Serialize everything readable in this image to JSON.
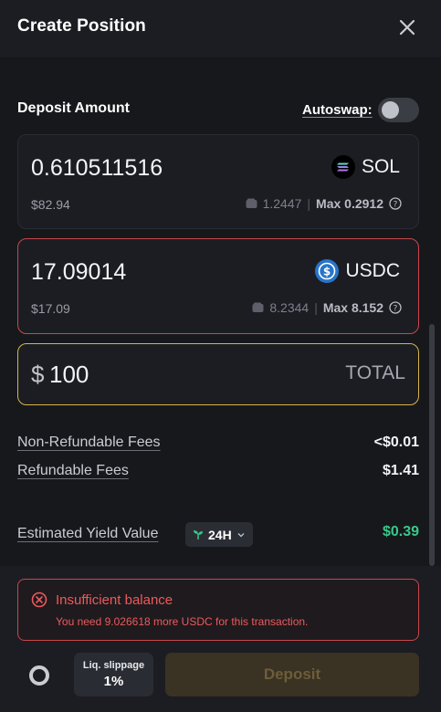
{
  "header": {
    "title": "Create Position"
  },
  "deposit": {
    "label": "Deposit Amount",
    "autoswap_label": "Autoswap:",
    "autoswap_on": false
  },
  "tokens": [
    {
      "amount": "0.610511516",
      "usd": "$82.94",
      "symbol": "SOL",
      "icon": "solana-logo-icon",
      "wallet_balance": "1.2447",
      "divider": "|",
      "max_label": "Max 0.2912"
    },
    {
      "amount": "17.09014",
      "usd": "$17.09",
      "symbol": "USDC",
      "icon": "usdc-logo-icon",
      "wallet_balance": "8.2344",
      "divider": "|",
      "max_label": "Max 8.152"
    }
  ],
  "total": {
    "currency": "$",
    "amount": "100",
    "label": "TOTAL"
  },
  "fees": {
    "non_refundable_label": "Non-Refundable Fees",
    "non_refundable_value": "<$0.01",
    "refundable_label": "Refundable Fees",
    "refundable_value": "$1.41"
  },
  "yield": {
    "label": "Estimated Yield Value",
    "period": "24H",
    "value": "$0.39"
  },
  "error": {
    "title": "Insufficient balance",
    "message": "You need 9.026618 more USDC for this transaction."
  },
  "footer": {
    "slippage_label": "Liq. slippage",
    "slippage_value": "1%",
    "deposit_label": "Deposit"
  },
  "colors": {
    "background": "#17181c",
    "error": "#ec5a5e",
    "total_border": "#d5b54a",
    "positive": "#38c98a",
    "usdc": "#2775ca"
  }
}
